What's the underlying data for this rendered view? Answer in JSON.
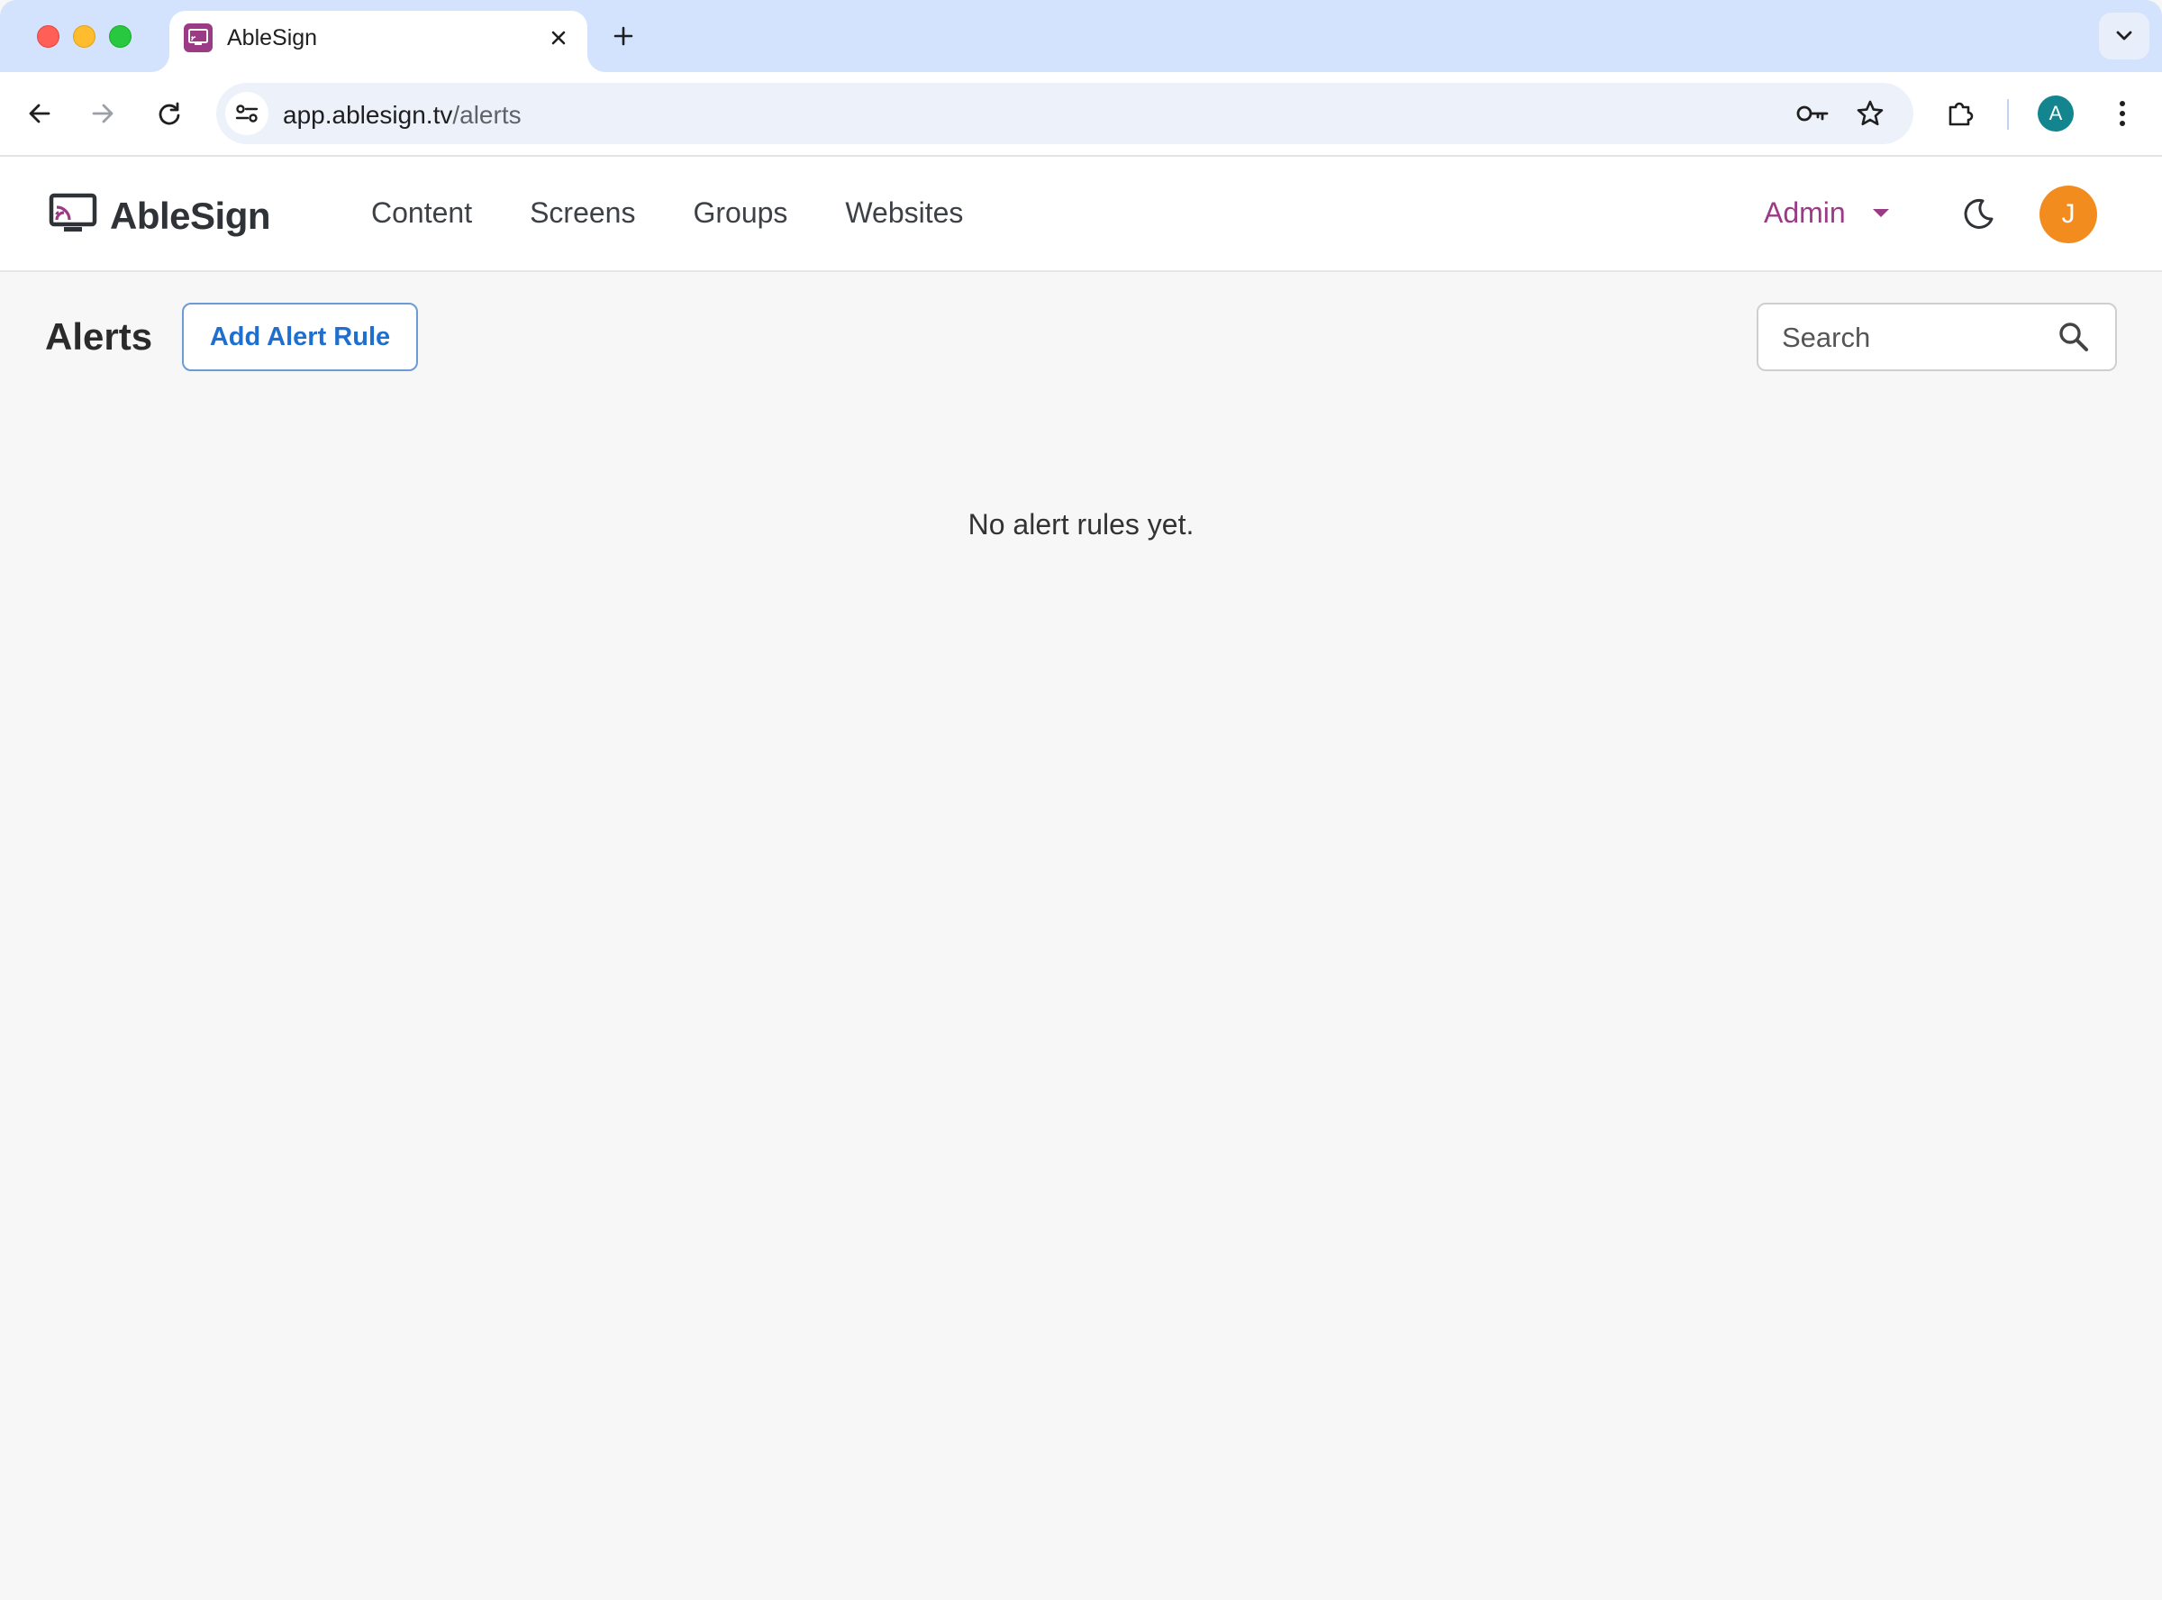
{
  "browser": {
    "tab_title": "AbleSign",
    "url_host": "app.ablesign.tv",
    "url_path": "/alerts",
    "profile_initial": "A"
  },
  "header": {
    "brand": "AbleSign",
    "nav": [
      {
        "label": "Content"
      },
      {
        "label": "Screens"
      },
      {
        "label": "Groups"
      },
      {
        "label": "Websites"
      }
    ],
    "admin_label": "Admin",
    "user_initial": "J"
  },
  "page": {
    "title": "Alerts",
    "add_button_label": "Add Alert Rule",
    "search_placeholder": "Search",
    "empty_message": "No alert rules yet."
  },
  "colors": {
    "brand": "#9b3b86",
    "accent_blue": "#1f6fd1",
    "avatar": "#f28c1e",
    "profile": "#12858f"
  },
  "icons": [
    "close-icon",
    "plus-icon",
    "chevron-down-icon",
    "back-arrow-icon",
    "forward-arrow-icon",
    "reload-icon",
    "tune-icon",
    "key-icon",
    "star-icon",
    "extension-icon",
    "more-vert-icon",
    "monitor-cast-icon",
    "moon-icon",
    "search-icon"
  ]
}
